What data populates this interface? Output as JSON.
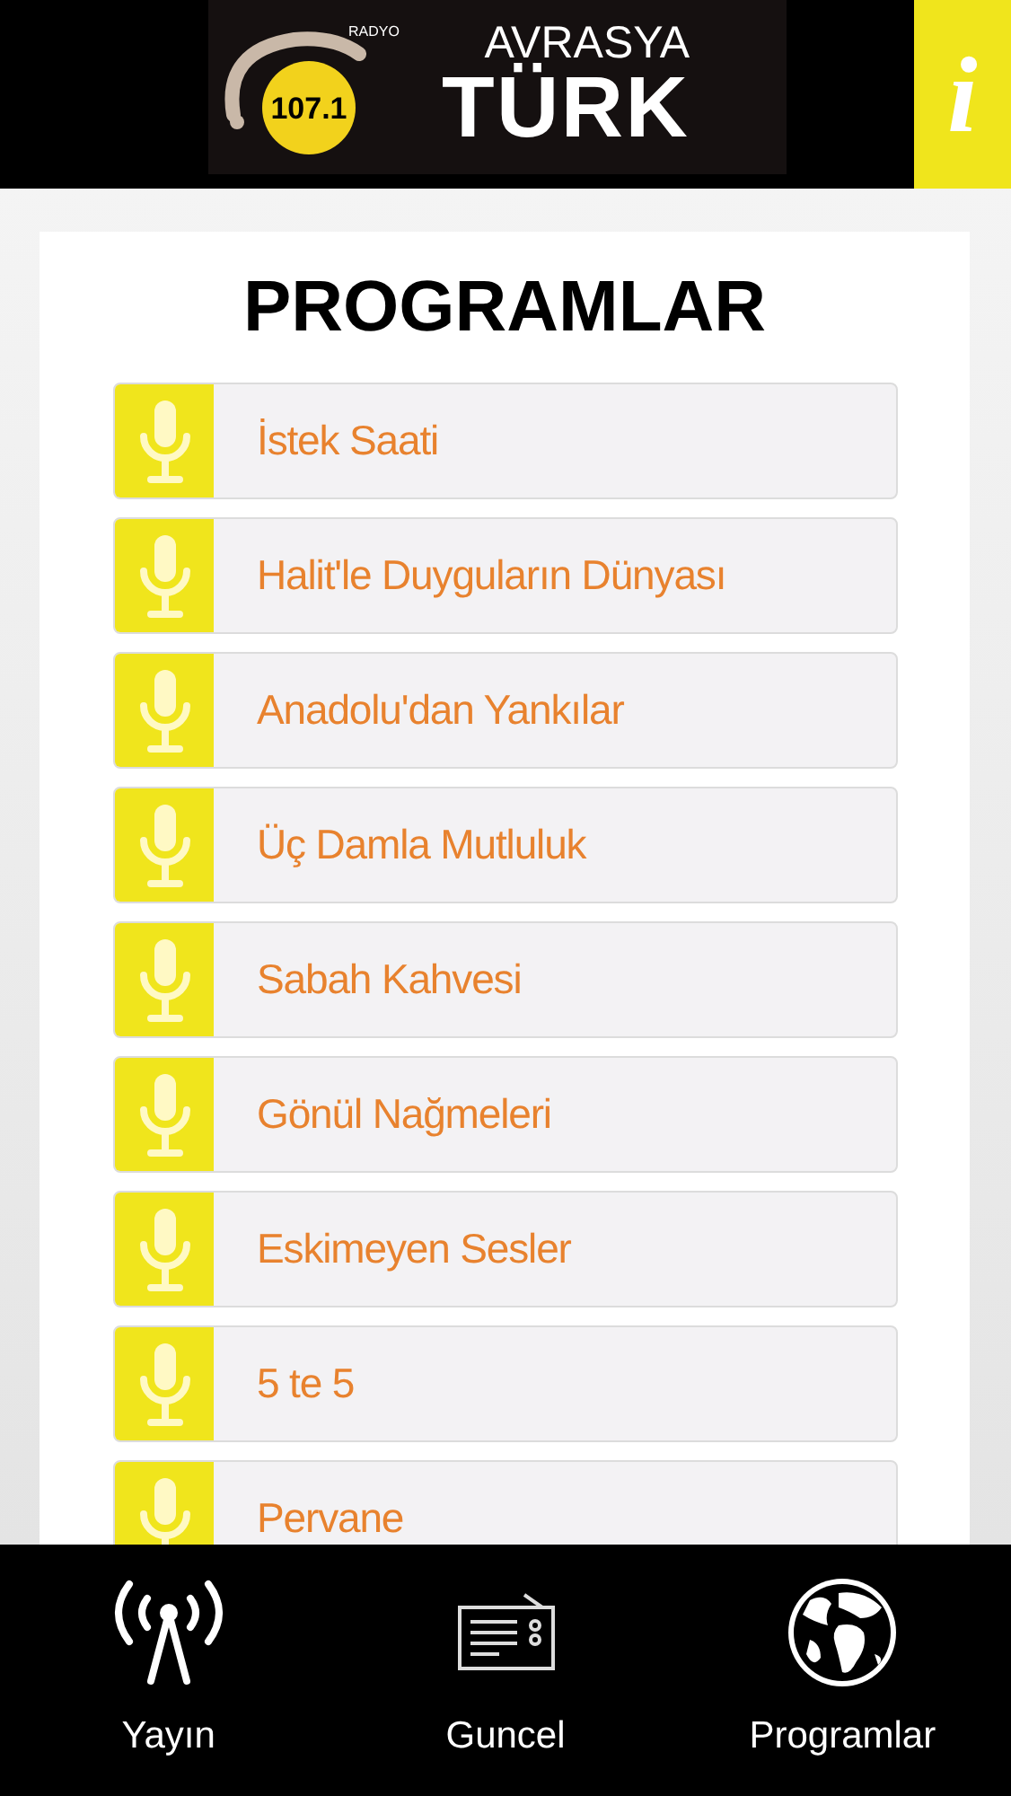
{
  "header": {
    "logo": {
      "radyo": "RADYO",
      "frequency": "107.1",
      "line_1": "AVRASYA",
      "line_2": "TÜRK"
    },
    "info_button": "i"
  },
  "page": {
    "title": "PROGRAMLAR",
    "programs": [
      {
        "name": "İstek Saati"
      },
      {
        "name": "Halit'le Duyguların Dünyası"
      },
      {
        "name": "Anadolu'dan Yankılar"
      },
      {
        "name": "Üç Damla Mutluluk"
      },
      {
        "name": "Sabah Kahvesi"
      },
      {
        "name": "Gönül Nağmeleri"
      },
      {
        "name": "Eskimeyen Sesler"
      },
      {
        "name": "5 te 5"
      },
      {
        "name": "Pervane"
      }
    ]
  },
  "bottom_nav": [
    {
      "kind": "broadcast",
      "label": "Yayın"
    },
    {
      "kind": "radio",
      "label": "Guncel"
    },
    {
      "kind": "globe",
      "label": "Programlar"
    }
  ]
}
